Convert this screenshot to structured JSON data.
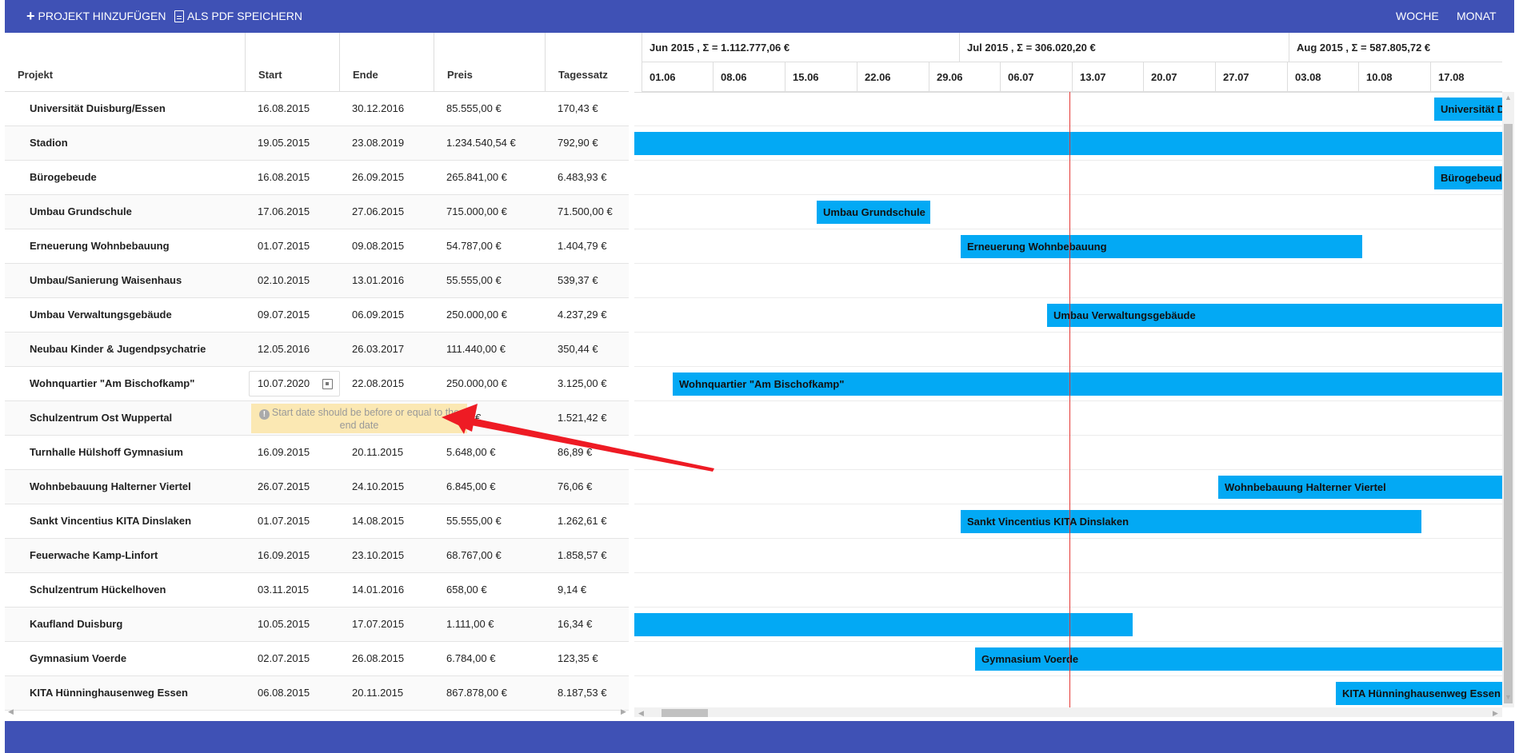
{
  "toolbar": {
    "add_project_label": "PROJEKT HINZUFÜGEN",
    "save_pdf_label": "ALS PDF SPEICHERN",
    "week_label": "WOCHE",
    "month_label": "MONAT"
  },
  "columns": {
    "name": "Projekt",
    "start": "Start",
    "end": "Ende",
    "price": "Preis",
    "rate": "Tagessatz"
  },
  "rows": [
    {
      "name": "Universität Duisburg/Essen",
      "start": "16.08.2015",
      "end": "30.12.2016",
      "price": "85.555,00 €",
      "rate": "170,43 €",
      "bar_label": "Universität Duisburg/Essen"
    },
    {
      "name": "Stadion",
      "start": "19.05.2015",
      "end": "23.08.2019",
      "price": "1.234.540,54 €",
      "rate": "792,90 €",
      "bar_label": ""
    },
    {
      "name": "Bürogebeude",
      "start": "16.08.2015",
      "end": "26.09.2015",
      "price": "265.841,00 €",
      "rate": "6.483,93 €",
      "bar_label": "Bürogebeude"
    },
    {
      "name": "Umbau Grundschule",
      "start": "17.06.2015",
      "end": "27.06.2015",
      "price": "715.000,00 €",
      "rate": "71.500,00 €",
      "bar_label": "Umbau Grundschule"
    },
    {
      "name": "Erneuerung Wohnbebauung",
      "start": "01.07.2015",
      "end": "09.08.2015",
      "price": "54.787,00 €",
      "rate": "1.404,79 €",
      "bar_label": "Erneuerung Wohnbebauung"
    },
    {
      "name": "Umbau/Sanierung Waisenhaus",
      "start": "02.10.2015",
      "end": "13.01.2016",
      "price": "55.555,00 €",
      "rate": "539,37 €",
      "bar_label": ""
    },
    {
      "name": "Umbau Verwaltungsgebäude",
      "start": "09.07.2015",
      "end": "06.09.2015",
      "price": "250.000,00 €",
      "rate": "4.237,29 €",
      "bar_label": "Umbau Verwaltungsgebäude"
    },
    {
      "name": "Neubau Kinder & Jugendpsychatrie",
      "start": "12.05.2016",
      "end": "26.03.2017",
      "price": "111.440,00 €",
      "rate": "350,44 €",
      "bar_label": ""
    },
    {
      "name": "Wohnquartier \"Am Bischofkamp\"",
      "start": "10.07.2020",
      "end": "22.08.2015",
      "price": "250.000,00 €",
      "rate": "3.125,00 €",
      "bar_label": "Wohnquartier \"Am Bischofkamp\""
    },
    {
      "name": "Schulzentrum Ost Wuppertal",
      "start": "",
      "end": "",
      "price": "54,00 €",
      "rate": "1.521,42 €",
      "bar_label": ""
    },
    {
      "name": "Turnhalle Hülshoff Gymnasium",
      "start": "16.09.2015",
      "end": "20.11.2015",
      "price": "5.648,00 €",
      "rate": "86,89 €",
      "bar_label": ""
    },
    {
      "name": "Wohnbebauung Halterner Viertel",
      "start": "26.07.2015",
      "end": "24.10.2015",
      "price": "6.845,00 €",
      "rate": "76,06 €",
      "bar_label": "Wohnbebauung Halterner Viertel"
    },
    {
      "name": "Sankt Vincentius KITA Dinslaken",
      "start": "01.07.2015",
      "end": "14.08.2015",
      "price": "55.555,00 €",
      "rate": "1.262,61 €",
      "bar_label": "Sankt Vincentius KITA Dinslaken"
    },
    {
      "name": "Feuerwache Kamp-Linfort",
      "start": "16.09.2015",
      "end": "23.10.2015",
      "price": "68.767,00 €",
      "rate": "1.858,57 €",
      "bar_label": ""
    },
    {
      "name": "Schulzentrum Hückelhoven",
      "start": "03.11.2015",
      "end": "14.01.2016",
      "price": "658,00 €",
      "rate": "9,14 €",
      "bar_label": ""
    },
    {
      "name": "Kaufland Duisburg",
      "start": "10.05.2015",
      "end": "17.07.2015",
      "price": "1.111,00 €",
      "rate": "16,34 €",
      "bar_label": ""
    },
    {
      "name": "Gymnasium Voerde",
      "start": "02.07.2015",
      "end": "26.08.2015",
      "price": "6.784,00 €",
      "rate": "123,35 €",
      "bar_label": "Gymnasium Voerde"
    },
    {
      "name": "KITA Hünninghausenweg Essen",
      "start": "06.08.2015",
      "end": "20.11.2015",
      "price": "867.878,00 €",
      "rate": "8.187,53 €",
      "bar_label": "KITA Hünninghausenweg Essen"
    }
  ],
  "editing": {
    "start_value": "10.07.2020",
    "tooltip": "Start date should be before or equal to the end date"
  },
  "gantt": {
    "months": [
      "Jun 2015 , Σ = 1.112.777,06 €",
      "Jul 2015 , Σ = 306.020,20 €",
      "Aug 2015 , Σ = 587.805,72 €"
    ],
    "weeks": [
      "01.06",
      "08.06",
      "15.06",
      "22.06",
      "29.06",
      "06.07",
      "13.07",
      "20.07",
      "27.07",
      "03.08",
      "10.08",
      "17.08"
    ],
    "bar_color": "#03a9f4",
    "today_line_color": "#e53935"
  },
  "colors": {
    "header_bg": "#3f51b5",
    "tooltip_bg": "#fbe8b3"
  }
}
